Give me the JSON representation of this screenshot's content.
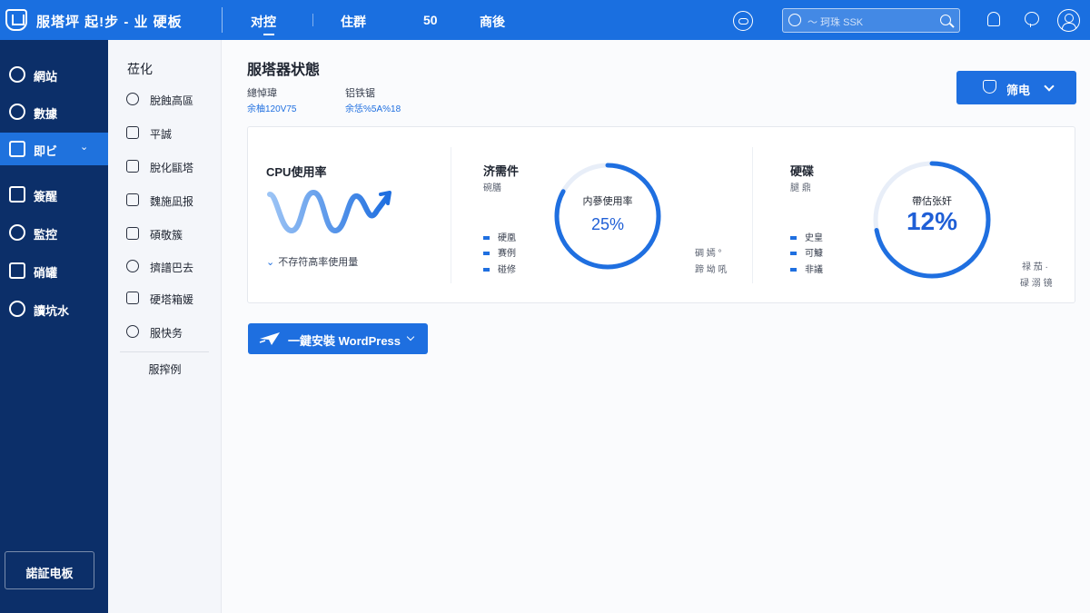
{
  "topbar": {
    "brand": "服塔坪 起!步 - 业 硬板",
    "nav": [
      "对控",
      "住群",
      "50",
      "商後"
    ],
    "search_placeholder": "～ 珂珠 SSK",
    "icons": [
      "refresh-icon",
      "search-icon",
      "bell-icon",
      "chat-icon",
      "user-icon"
    ]
  },
  "sidebar": {
    "items": [
      {
        "label": "網站",
        "icon": "globe-icon"
      },
      {
        "label": "數據",
        "icon": "database-icon"
      },
      {
        "label": "即ビ",
        "icon": "monitor-icon"
      },
      {
        "label": "簽醒",
        "icon": "file-icon"
      },
      {
        "label": "監控",
        "icon": "shield-icon"
      },
      {
        "label": "硝罐",
        "icon": "list-icon"
      },
      {
        "label": "讀坑水",
        "icon": "loop-icon"
      }
    ],
    "active_index": 2,
    "bottom_button": "諾証电板"
  },
  "submenu": {
    "title": "莅化",
    "items": [
      {
        "label": "脫蝕高區",
        "icon": "clock-icon"
      },
      {
        "label": "平誠",
        "icon": "edit-icon"
      },
      {
        "label": "脫化甌塔",
        "icon": "chart-icon"
      },
      {
        "label": "魏施凪报",
        "icon": "lock-icon"
      },
      {
        "label": "碩敬簇",
        "icon": "download-icon"
      },
      {
        "label": "擠譜巴去",
        "icon": "phone-icon"
      },
      {
        "label": "硬塔箱媛",
        "icon": "shield-icon"
      },
      {
        "label": "服快务",
        "icon": "face-icon"
      }
    ],
    "footer": "服搾例"
  },
  "main": {
    "title": "服塔器状態",
    "meta": [
      {
        "label": "總悼瑋",
        "value": "余柚120V75"
      },
      {
        "label": "铝铁锯",
        "value": "余恁%5A%18"
      }
    ],
    "filter_button": "筛电",
    "cpu": {
      "title": "CPU使用率",
      "footer": "不存符高率使用量"
    },
    "memory": {
      "title": "济需件",
      "subtitle": "碗膳",
      "gauge_label": "内蔘使用率",
      "gauge_value": "25%",
      "percent": 25,
      "legend": [
        "硬凰",
        "赛例",
        "碰修"
      ],
      "side_notes": [
        "碉 嫣 °",
        "蹄 坳 吼"
      ]
    },
    "disk": {
      "title": "硬碟",
      "subtitle": "腿 鼎",
      "gauge_label": "帶估张奸",
      "gauge_value": "12%",
      "percent": 12,
      "legend": [
        "史皇",
        "可鱇",
        "非議"
      ],
      "side_notes": [
        "禄 茄 ·",
        "碌 溺 镜"
      ]
    },
    "wp_button": "一鍵安裝 WordPress"
  }
}
